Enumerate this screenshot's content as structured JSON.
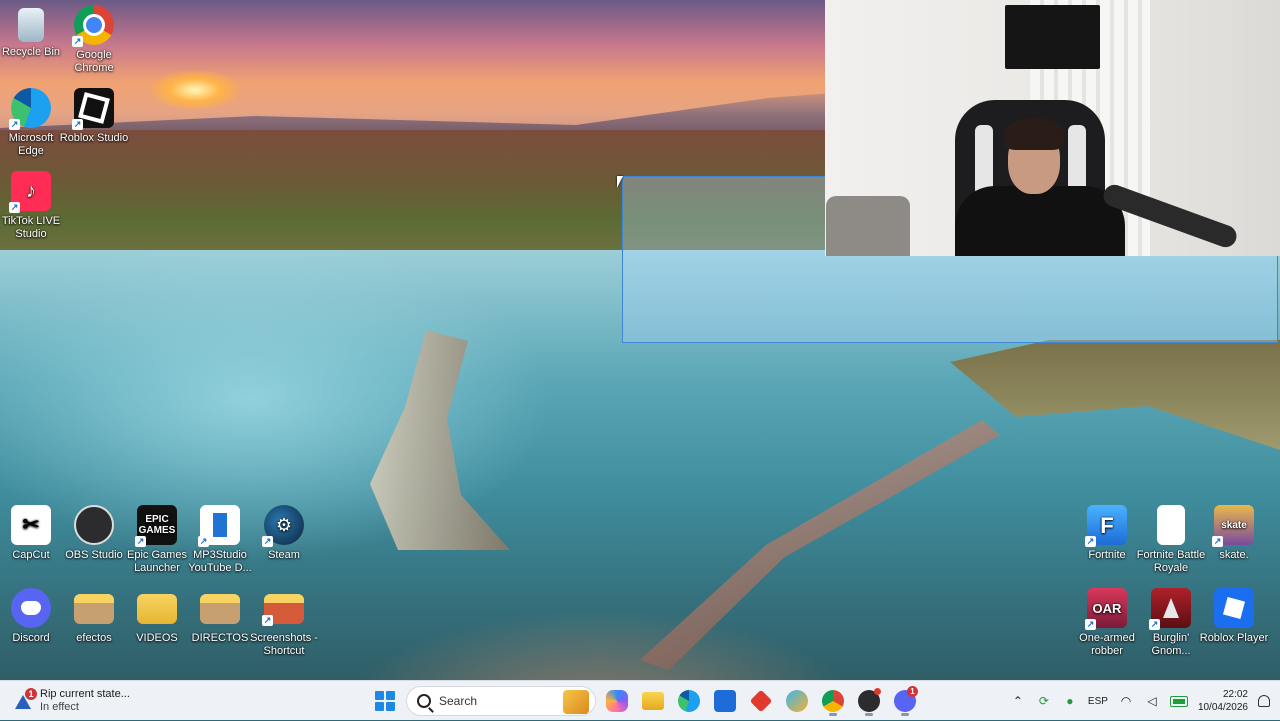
{
  "desktop": {
    "icons": [
      {
        "id": "recycle-bin",
        "label": "Recycle Bin",
        "icon": "recycle-bin-icon"
      },
      {
        "id": "google-chrome",
        "label": "Google Chrome",
        "icon": "chrome-icon"
      },
      {
        "id": "microsoft-edge",
        "label": "Microsoft Edge",
        "icon": "edge-icon"
      },
      {
        "id": "roblox-studio",
        "label": "Roblox Studio",
        "icon": "roblox-studio-icon"
      },
      {
        "id": "tiktok-live-studio",
        "label": "TikTok LIVE Studio",
        "icon": "tiktok-icon"
      },
      {
        "id": "capcut",
        "label": "CapCut",
        "icon": "capcut-icon",
        "glyph": "✂"
      },
      {
        "id": "obs-studio",
        "label": "OBS Studio",
        "icon": "obs-icon"
      },
      {
        "id": "epic-games",
        "label": "Epic Games Launcher",
        "icon": "epic-games-icon",
        "glyph": "EPIC GAMES"
      },
      {
        "id": "mp3studio",
        "label": "MP3Studio YouTube D...",
        "icon": "mp3studio-icon"
      },
      {
        "id": "steam",
        "label": "Steam",
        "icon": "steam-icon",
        "glyph": "⚙"
      },
      {
        "id": "discord",
        "label": "Discord",
        "icon": "discord-icon"
      },
      {
        "id": "efectos",
        "label": "efectos",
        "icon": "folder-icon"
      },
      {
        "id": "videos",
        "label": "VIDEOS",
        "icon": "folder-icon"
      },
      {
        "id": "directos",
        "label": "DIRECTOS",
        "icon": "folder-icon"
      },
      {
        "id": "screenshots",
        "label": "Screenshots - Shortcut",
        "icon": "folder-shortcut-icon"
      },
      {
        "id": "fortnite",
        "label": "Fortnite",
        "icon": "fortnite-icon",
        "glyph": "F"
      },
      {
        "id": "fortnite-br",
        "label": "Fortnite Battle Royale",
        "icon": "document-icon"
      },
      {
        "id": "skate",
        "label": "skate.",
        "icon": "skate-icon",
        "glyph": "skate"
      },
      {
        "id": "one-armed-robber",
        "label": "One-armed robber",
        "icon": "one-armed-robber-icon",
        "glyph": "OAR"
      },
      {
        "id": "burglin-gnomes",
        "label": "Burglin' Gnom...",
        "icon": "gnome-icon"
      },
      {
        "id": "roblox-player",
        "label": "Roblox Player",
        "icon": "roblox-player-icon"
      }
    ]
  },
  "notification": {
    "badge": "1",
    "title": "Rip current state...",
    "subtitle": "In effect"
  },
  "taskbar": {
    "search_placeholder": "Search",
    "discord_badge": "1"
  },
  "tray": {
    "language": "ESP",
    "time": "22:02",
    "date": "10/04/2026"
  },
  "colors": {
    "taskbar_bg": "#eef1f6",
    "accent": "#1e88e5",
    "selection": "#3d86d6"
  }
}
